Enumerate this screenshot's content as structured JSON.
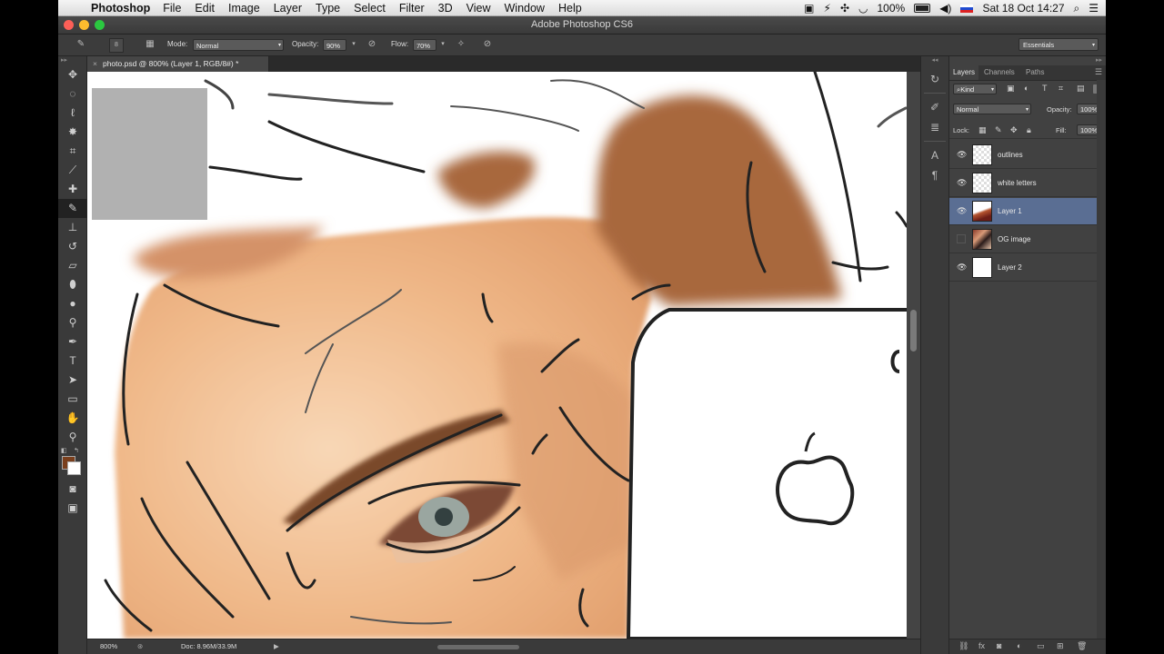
{
  "menubar": {
    "app_name": "Photoshop",
    "items": [
      "File",
      "Edit",
      "Image",
      "Layer",
      "Type",
      "Select",
      "Filter",
      "3D",
      "View",
      "Window",
      "Help"
    ],
    "battery": "100%",
    "datetime": "Sat 18 Oct  14:27"
  },
  "window": {
    "title": "Adobe Photoshop CS6"
  },
  "options": {
    "mode_label": "Mode:",
    "mode_value": "Normal",
    "opacity_label": "Opacity:",
    "opacity_value": "90%",
    "flow_label": "Flow:",
    "flow_value": "70%",
    "brush_size": "8",
    "workspace": "Essentials"
  },
  "document": {
    "tab_title": "photo.psd @ 800% (Layer 1, RGB/8#) *",
    "zoom": "800%",
    "doc_size": "Doc: 8.96M/33.9M"
  },
  "colors": {
    "foreground": "#7a3f1d",
    "background": "#ffffff",
    "selected_layer": "#5a6e93"
  },
  "layers_panel": {
    "tabs": [
      "Layers",
      "Channels",
      "Paths"
    ],
    "filter_kind": "Kind",
    "blend_mode": "Normal",
    "opacity_label": "Opacity:",
    "opacity_value": "100%",
    "lock_label": "Lock:",
    "fill_label": "Fill:",
    "fill_value": "100%",
    "layers": [
      {
        "name": "outlines",
        "visible": true,
        "selected": false
      },
      {
        "name": "white letters",
        "visible": true,
        "selected": false
      },
      {
        "name": "Layer 1",
        "visible": true,
        "selected": true
      },
      {
        "name": "OG image",
        "visible": false,
        "selected": false
      },
      {
        "name": "Layer 2",
        "visible": true,
        "selected": false
      }
    ]
  }
}
